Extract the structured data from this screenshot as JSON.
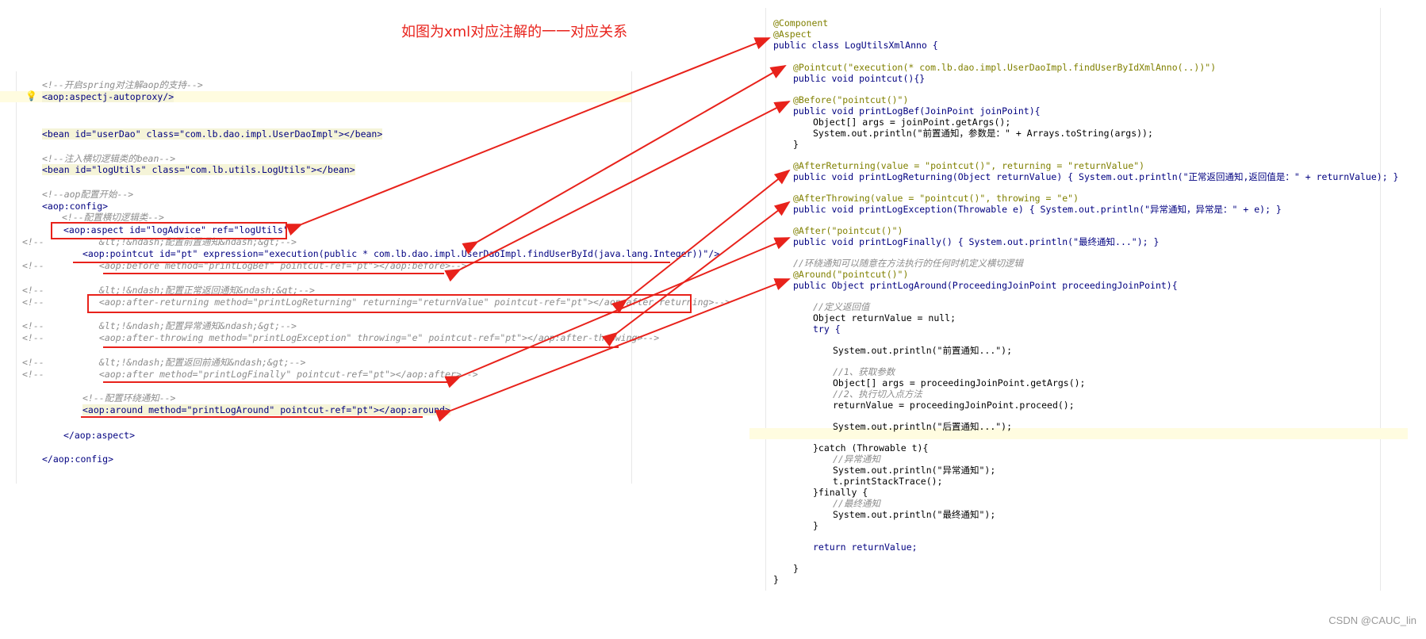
{
  "title": "如图为xml对应注解的一一对应关系",
  "watermark": "CSDN @CAUC_lin",
  "xml_lines": [
    "<!--开启spring对注解aop的支持-->",
    "<aop:aspectj-autoproxy/>",
    "<bean id=\"userDao\" class=\"com.lb.dao.impl.UserDaoImpl\"></bean>",
    "<!--注入横切逻辑类的bean-->",
    "<bean id=\"logUtils\" class=\"com.lb.utils.LogUtils\"></bean>",
    "<!--aop配置开始-->",
    "<aop:config>",
    "<!--配置横切逻辑类-->",
    "<aop:aspect id=\"logAdvice\" ref=\"logUtils\">",
    "<!--          &lt;!&ndash;配置前置通知&ndash;&gt;-->",
    "<aop:pointcut id=\"pt\" expression=\"execution(public * com.lb.dao.impl.UserDaoImpl.findUserById(java.lang.Integer))\"/>",
    "<!--          <aop:before method=\"printLogBef\" pointcut-ref=\"pt\"></aop:before>-->",
    "<!--          &lt;!&ndash;配置正常返回通知&ndash;&gt;-->",
    "<!--          <aop:after-returning method=\"printLogReturning\" returning=\"returnValue\" pointcut-ref=\"pt\"></aop:after-returning>-->",
    "<!--          &lt;!&ndash;配置异常通知&ndash;&gt;-->",
    "<!--          <aop:after-throwing method=\"printLogException\" throwing=\"e\" pointcut-ref=\"pt\"></aop:after-throwing>-->",
    "<!--          &lt;!&ndash;配置返回前通知&ndash;&gt;-->",
    "<!--          <aop:after method=\"printLogFinally\" pointcut-ref=\"pt\"></aop:after>-->",
    "<!--配置环绕通知-->",
    "<aop:around method=\"printLogAround\" pointcut-ref=\"pt\"></aop:around>",
    "</aop:aspect>",
    "</aop:config>"
  ],
  "java_lines": [
    "@Component",
    "@Aspect",
    "public class LogUtilsXmlAnno {",
    "@Pointcut(\"execution(* com.lb.dao.impl.UserDaoImpl.findUserByIdXmlAnno(..))\")",
    "public void pointcut(){}",
    "@Before(\"pointcut()\")",
    "public void printLogBef(JoinPoint joinPoint){",
    "Object[] args = joinPoint.getArgs();",
    "System.out.println(\"前置通知，参数是：\" + Arrays.toString(args));",
    "}",
    "@AfterReturning(value = \"pointcut()\", returning = \"returnValue\")",
    "public void printLogReturning(Object returnValue) { System.out.println(\"正常返回通知,返回值是：\" + returnValue); }",
    "@AfterThrowing(value = \"pointcut()\", throwing = \"e\")",
    "public void printLogException(Throwable e) { System.out.println(\"异常通知，异常是：\" + e); }",
    "@After(\"pointcut()\")",
    "public void printLogFinally() { System.out.println(\"最终通知...\"); }",
    "//环绕通知可以随意在方法执行的任何时机定义横切逻辑",
    "@Around(\"pointcut()\")",
    "public Object printLogAround(ProceedingJoinPoint proceedingJoinPoint){",
    "//定义返回值",
    "Object returnValue = null;",
    "try {",
    "System.out.println(\"前置通知...\");",
    "//1、获取参数",
    "Object[] args = proceedingJoinPoint.getArgs();",
    "//2、执行切入点方法",
    "returnValue = proceedingJoinPoint.proceed();",
    "System.out.println(\"后置通知...\");",
    "}catch (Throwable t){",
    "//异常通知",
    "System.out.println(\"异常通知\");",
    "t.printStackTrace();",
    "}finally {",
    "//最终通知",
    "System.out.println(\"最终通知\");",
    "}",
    "return returnValue;",
    "}",
    "}"
  ],
  "colors": {
    "annotation_red": "#e8221b",
    "comment": "#8c8c8c",
    "tag": "#000080",
    "attr": "#0000ff",
    "string": "#008000",
    "java_annotation": "#808000"
  }
}
